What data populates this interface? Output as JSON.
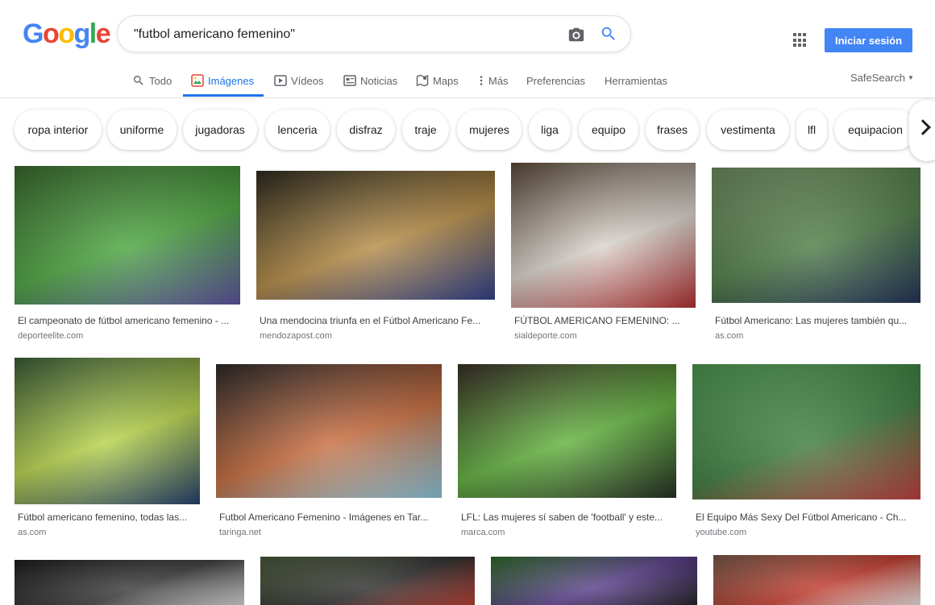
{
  "logo": {
    "letters": [
      "G",
      "o",
      "o",
      "g",
      "l",
      "e"
    ],
    "colors": [
      "#4285f4",
      "#ea4335",
      "#fbbc05",
      "#4285f4",
      "#34a853",
      "#ea4335"
    ]
  },
  "search": {
    "query": "\"futbol americano femenino\"",
    "camera_icon": "camera-icon",
    "search_icon": "search-icon"
  },
  "header": {
    "signin_label": "Iniciar sesión",
    "apps_icon": "apps-grid-icon"
  },
  "tabs": [
    {
      "label": "Todo",
      "icon": "search-icon"
    },
    {
      "label": "Imágenes",
      "icon": "image-icon",
      "active": true
    },
    {
      "label": "Vídeos",
      "icon": "play-icon"
    },
    {
      "label": "Noticias",
      "icon": "news-icon"
    },
    {
      "label": "Maps",
      "icon": "map-icon"
    },
    {
      "label": "Más",
      "icon": "more-vert-icon"
    },
    {
      "label": "Preferencias"
    },
    {
      "label": "Herramientas"
    }
  ],
  "safesearch": {
    "label": "SafeSearch"
  },
  "chips": [
    "ropa interior",
    "uniforme",
    "jugadoras",
    "lenceria",
    "disfraz",
    "traje",
    "mujeres",
    "liga",
    "equipo",
    "frases",
    "vestimenta",
    "lfl",
    "equipacion"
  ],
  "results": [
    {
      "caption": "El campeonato de fútbol americano femenino - ...",
      "domain": "deporteelite.com",
      "colors": [
        "#3a6b2f",
        "#4aa53e",
        "#5b4fa1"
      ]
    },
    {
      "caption": "Una mendocina triunfa en el Fútbol Americano Fe...",
      "domain": "mendozapost.com",
      "colors": [
        "#2d2a1e",
        "#b68c45",
        "#2a3c8a"
      ]
    },
    {
      "caption": "FÚTBOL AMERICANO FEMENINO: ...",
      "domain": "sialdeporte.com",
      "colors": [
        "#5c4a3a",
        "#d9d3cc",
        "#b32a2a"
      ]
    },
    {
      "caption": "Fútbol Americano: Las mujeres también qu...",
      "domain": "as.com",
      "colors": [
        "#6f8f62",
        "#4e7c45",
        "#1c2d54"
      ]
    },
    {
      "caption": "Fútbol americano femenino, todas las...",
      "domain": "as.com",
      "colors": [
        "#3b5f3a",
        "#b8d34a",
        "#1d3b6b"
      ]
    },
    {
      "caption": "Futbol Americano Femenino - Imágenes en Tar...",
      "domain": "taringa.net",
      "colors": [
        "#2c2a2a",
        "#c86b3c",
        "#8cc9e0"
      ]
    },
    {
      "caption": "LFL: Las mujeres sí saben de 'football' y este...",
      "domain": "marca.com",
      "colors": [
        "#3a3026",
        "#61b23d",
        "#1f2a1c"
      ]
    },
    {
      "caption": "El Equipo Más Sexy Del Fútbol Americano - Ch...",
      "domain": "youtube.com",
      "colors": [
        "#4f9a52",
        "#3c7d3f",
        "#c23a3a"
      ]
    },
    {
      "caption": "",
      "domain": "",
      "colors": [
        "#1c1c1c",
        "#3a3a3a",
        "#e0e0e0"
      ]
    },
    {
      "caption": "",
      "domain": "",
      "colors": [
        "#4a5a3a",
        "#2d2d2d",
        "#c0392b"
      ]
    },
    {
      "caption": "",
      "domain": "",
      "colors": [
        "#2f6b2a",
        "#5a3e8c",
        "#1a1a1a"
      ]
    },
    {
      "caption": "",
      "domain": "",
      "colors": [
        "#7a5a4a",
        "#c0392b",
        "#f0f0f0"
      ]
    }
  ]
}
